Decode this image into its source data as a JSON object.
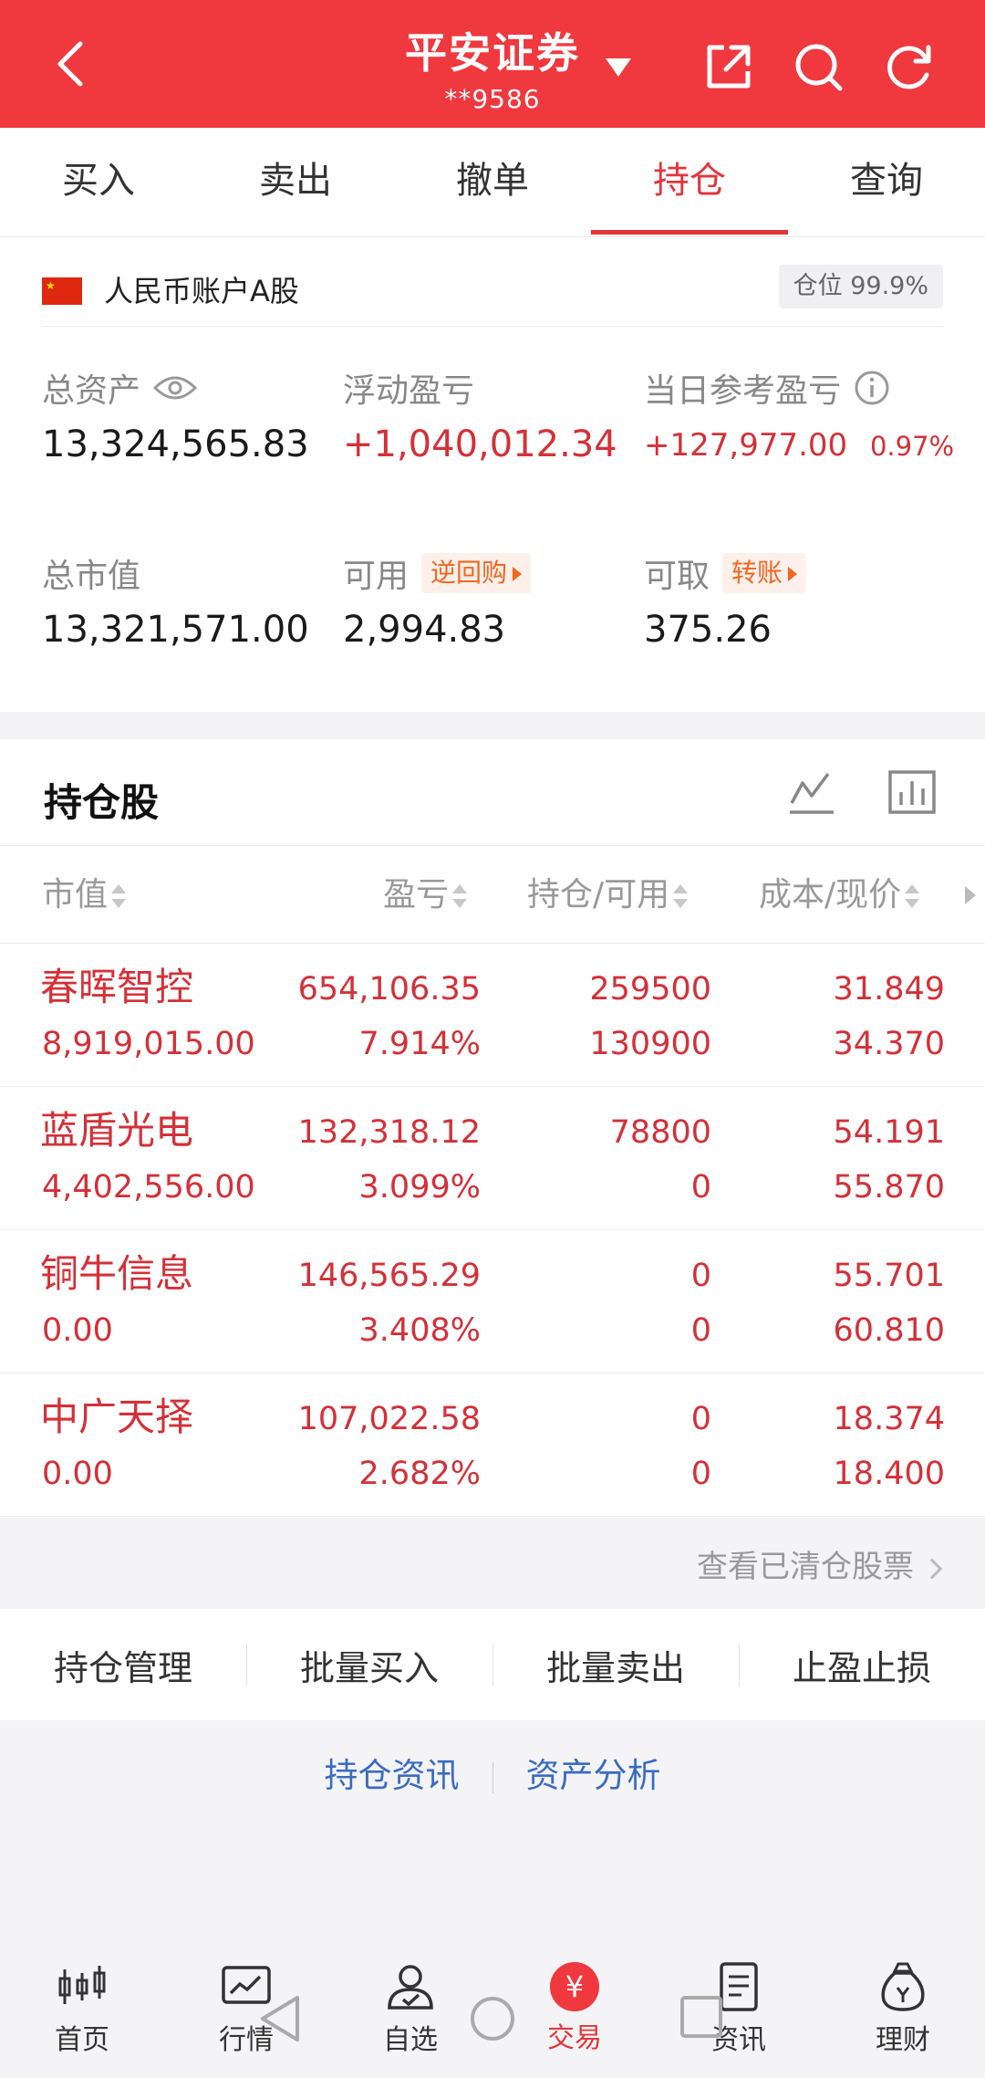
{
  "header": {
    "title": "平安证券",
    "account": "**9586"
  },
  "tabs": [
    {
      "label": "买入"
    },
    {
      "label": "卖出"
    },
    {
      "label": "撤单"
    },
    {
      "label": "持仓",
      "active": true
    },
    {
      "label": "查询"
    }
  ],
  "account": {
    "name": "人民币账户A股",
    "position_label": "仓位 99.9%",
    "total_assets_label": "总资产",
    "total_assets": "13,324,565.83",
    "floating_pl_label": "浮动盈亏",
    "floating_pl": "+1,040,012.34",
    "daily_pl_label": "当日参考盈亏",
    "daily_pl": "+127,977.00",
    "daily_pl_pct": "0.97%",
    "market_value_label": "总市值",
    "market_value": "13,321,571.00",
    "available_label": "可用",
    "available_tag": "逆回购",
    "available": "2,994.83",
    "withdrawable_label": "可取",
    "withdrawable_tag": "转账",
    "withdrawable": "375.26"
  },
  "holdings": {
    "title": "持仓股",
    "columns": [
      "市值",
      "盈亏",
      "持仓/可用",
      "成本/现价"
    ],
    "rows": [
      {
        "name": "春晖智控",
        "market_value": "8,919,015.00",
        "pl": "654,106.35",
        "pl_pct": "7.914%",
        "position": "259500",
        "available": "130900",
        "cost": "31.849",
        "price": "34.370"
      },
      {
        "name": "蓝盾光电",
        "market_value": "4,402,556.00",
        "pl": "132,318.12",
        "pl_pct": "3.099%",
        "position": "78800",
        "available": "0",
        "cost": "54.191",
        "price": "55.870"
      },
      {
        "name": "铜牛信息",
        "market_value": "0.00",
        "pl": "146,565.29",
        "pl_pct": "3.408%",
        "position": "0",
        "available": "0",
        "cost": "55.701",
        "price": "60.810"
      },
      {
        "name": "中广天择",
        "market_value": "0.00",
        "pl": "107,022.58",
        "pl_pct": "2.682%",
        "position": "0",
        "available": "0",
        "cost": "18.374",
        "price": "18.400"
      }
    ],
    "cleared_link": "查看已清仓股票"
  },
  "actions": [
    "持仓管理",
    "批量买入",
    "批量卖出",
    "止盈止损"
  ],
  "links": [
    "持仓资讯",
    "资产分析"
  ],
  "bottom_nav": [
    {
      "label": "首页",
      "icon": "candlestick-icon"
    },
    {
      "label": "行情",
      "icon": "chart-icon"
    },
    {
      "label": "自选",
      "icon": "user-check-icon"
    },
    {
      "label": "交易",
      "icon": "yuan-icon",
      "glyph": "¥",
      "active": true
    },
    {
      "label": "资讯",
      "icon": "document-icon"
    },
    {
      "label": "理财",
      "icon": "money-bag-icon"
    }
  ],
  "colors": {
    "brand": "#f0383f",
    "gain": "#d43038",
    "link": "#3a6bc4",
    "tag": "#f2661f"
  }
}
